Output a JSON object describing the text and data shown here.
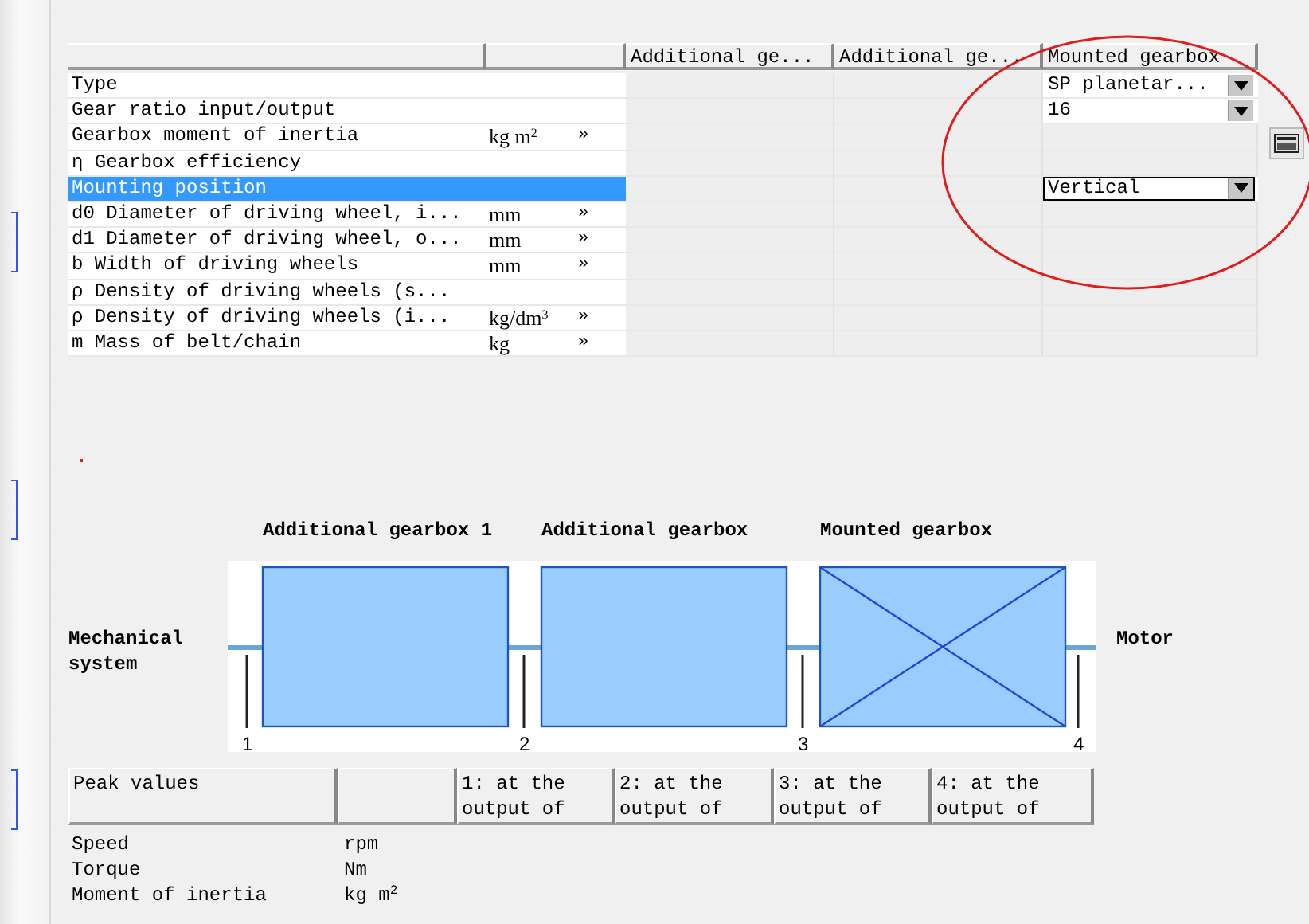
{
  "table": {
    "columns": [
      "",
      "",
      "Additional ge...",
      "Additional ge...",
      "Mounted gearbox"
    ],
    "rows": [
      {
        "label": "Type",
        "unit": "",
        "more": "",
        "selected": false,
        "mounted": {
          "kind": "dropdown",
          "value": "SP planetar...",
          "focused": false
        }
      },
      {
        "label": "Gear ratio input/output",
        "unit": "",
        "more": "",
        "selected": false,
        "mounted": {
          "kind": "dropdown",
          "value": "16",
          "focused": false
        }
      },
      {
        "label": "Gearbox moment of inertia",
        "unit": "kg m$^{2}$",
        "more": "»",
        "selected": false,
        "mounted": {
          "kind": "empty"
        }
      },
      {
        "label": "η  Gearbox efficiency",
        "unit": "",
        "more": "",
        "selected": false,
        "mounted": {
          "kind": "empty"
        }
      },
      {
        "label": "Mounting position",
        "unit": "",
        "more": "",
        "selected": true,
        "mounted": {
          "kind": "dropdown",
          "value": "Vertical",
          "focused": true
        }
      },
      {
        "label": "d0 Diameter of driving wheel, i...",
        "unit": "mm",
        "more": "»",
        "selected": false,
        "mounted": {
          "kind": "empty"
        }
      },
      {
        "label": "d1 Diameter of driving wheel, o...",
        "unit": "mm",
        "more": "»",
        "selected": false,
        "mounted": {
          "kind": "empty"
        }
      },
      {
        "label": "b Width of driving wheels",
        "unit": "mm",
        "more": "»",
        "selected": false,
        "mounted": {
          "kind": "empty"
        }
      },
      {
        "label": "ρ  Density of driving wheels (s...",
        "unit": "",
        "more": "",
        "selected": false,
        "mounted": {
          "kind": "empty"
        }
      },
      {
        "label": "ρ  Density of driving wheels (i...",
        "unit": "kg/dm$^{3}$",
        "more": "»",
        "selected": false,
        "mounted": {
          "kind": "empty"
        }
      },
      {
        "label": "m Mass of belt/chain",
        "unit": "kg",
        "more": "»",
        "selected": false,
        "mounted": {
          "kind": "empty"
        }
      }
    ]
  },
  "diagram": {
    "left_label": [
      "Mechanical",
      "system"
    ],
    "right_label": "Motor",
    "stages": [
      {
        "title": "Additional gearbox 1",
        "kind": "plain"
      },
      {
        "title": "Additional gearbox",
        "kind": "plain"
      },
      {
        "title": "Mounted gearbox",
        "kind": "crossed"
      }
    ],
    "points": [
      "1",
      "2",
      "3",
      "4"
    ]
  },
  "peak_table": {
    "columns": [
      "Peak values",
      "",
      "1: at the output of",
      "2: at the output of",
      "3: at the output of",
      "4: at the output of"
    ],
    "rows": [
      {
        "label": "Speed",
        "unit": "rpm"
      },
      {
        "label": "Torque",
        "unit": "Nm"
      },
      {
        "label": "Moment of inertia",
        "unit": "kg m$^{2}$"
      }
    ]
  }
}
